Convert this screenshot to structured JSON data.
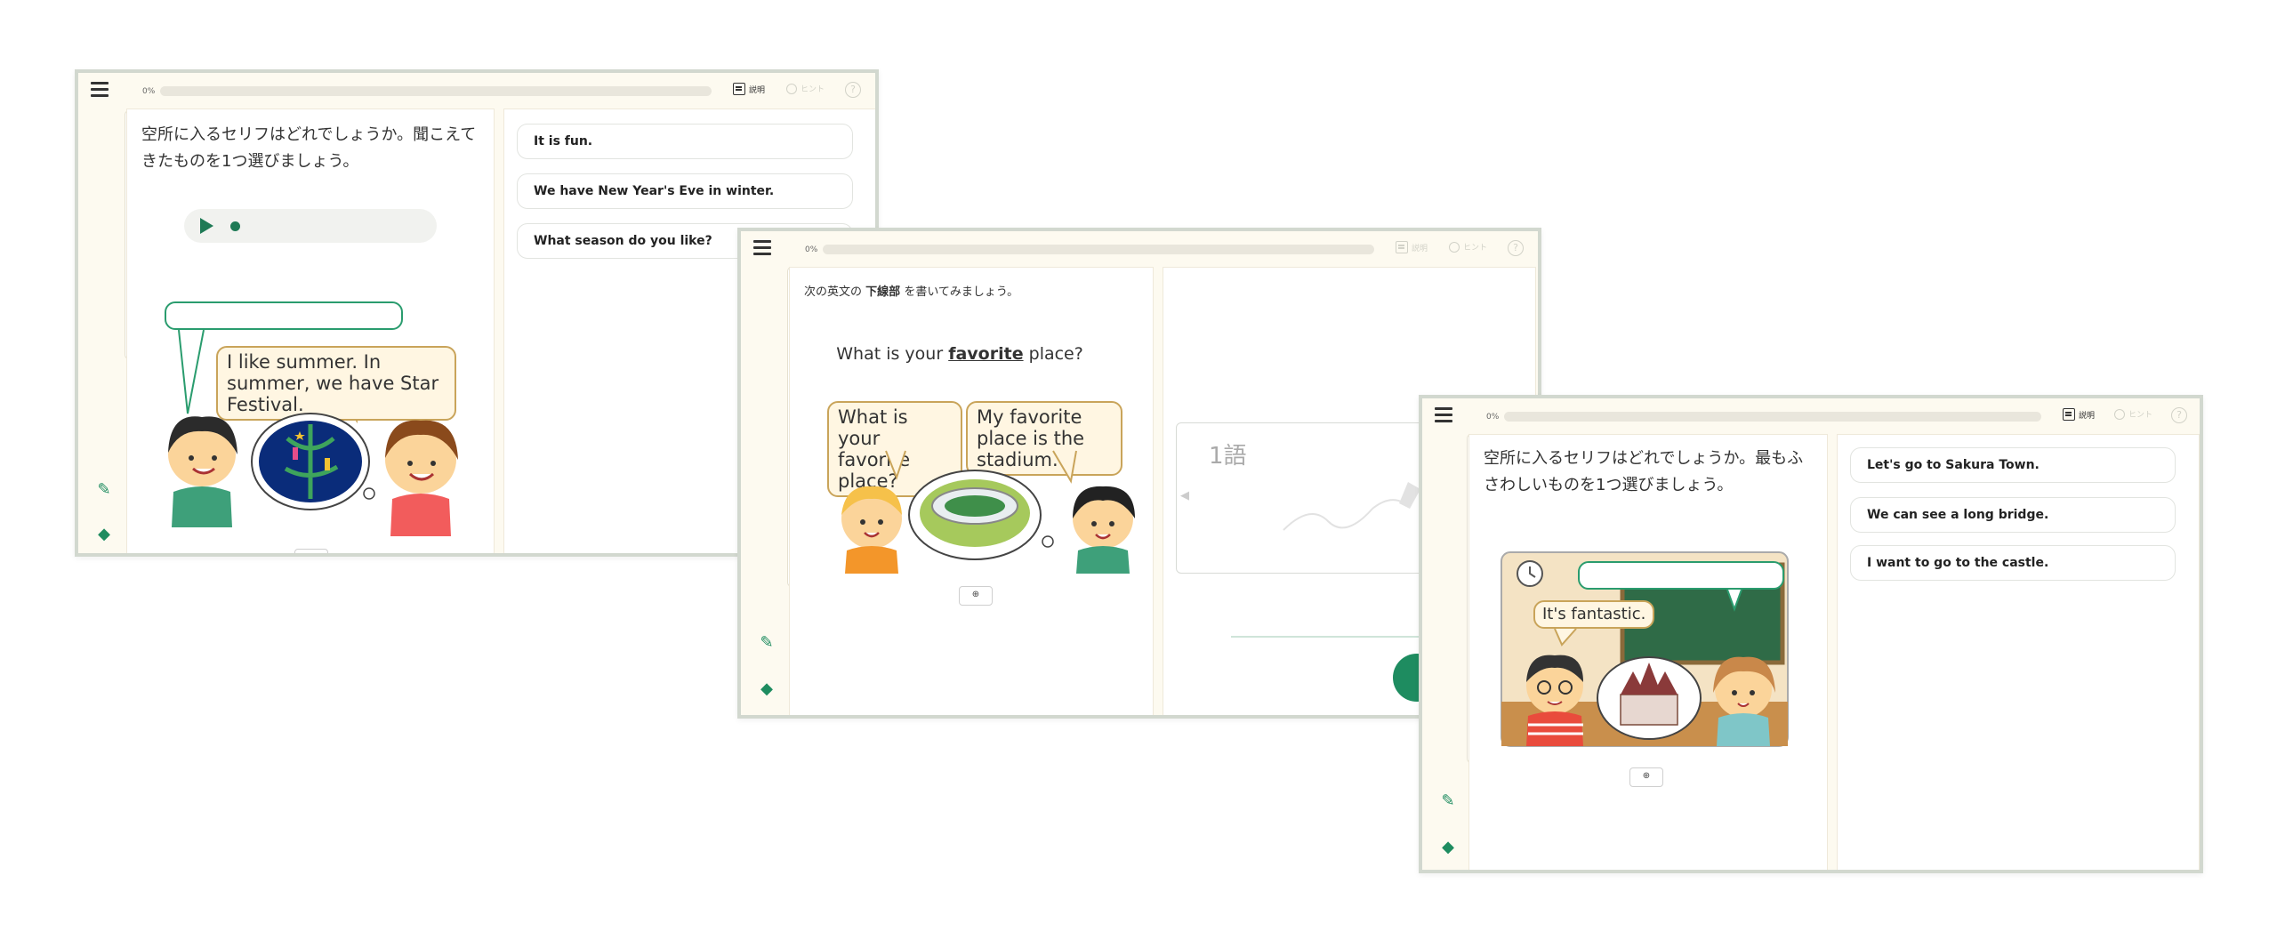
{
  "colors": {
    "accent": "#1e8c60",
    "frame": "#d2d8cf",
    "bubble_border": "#c9a45a",
    "panel_bg": "#fdfaf0"
  },
  "windows": [
    {
      "progress_label": "0%",
      "progress": 0,
      "explain_label": "説明",
      "hint_label": "ヒント",
      "help_label": "?",
      "prompt": "空所に入るセリフはどれでしょうか。聞こえてきたものを1つ選びましょう。",
      "bubble_text": "I like summer. In summer, we have Star Festival.",
      "choices": [
        "It is fun.",
        "We have New Year's Eve in winter.",
        "What season do you like?"
      ]
    },
    {
      "progress_label": "0%",
      "progress": 0,
      "explain_label": "説明",
      "hint_label": "ヒント",
      "help_label": "?",
      "instruction_prefix": "次の英文の",
      "instruction_bold": "下線部",
      "instruction_suffix": "を書いてみましょう。",
      "sentence_before": "What is your ",
      "sentence_target": "favorite",
      "sentence_after": " place?",
      "bubble_left": "What is your favorite place?",
      "bubble_right": "My favorite place is the stadium.",
      "word_count_label": "1語"
    },
    {
      "progress_label": "0%",
      "progress": 0,
      "explain_label": "説明",
      "hint_label": "ヒント",
      "help_label": "?",
      "prompt": "空所に入るセリフはどれでしょうか。最もふさわしいものを1つ選びましょう。",
      "bubble_text": "It's fantastic.",
      "choices": [
        "Let's go to Sakura Town.",
        "We can see a long bridge.",
        "I want to go to the castle."
      ]
    }
  ]
}
